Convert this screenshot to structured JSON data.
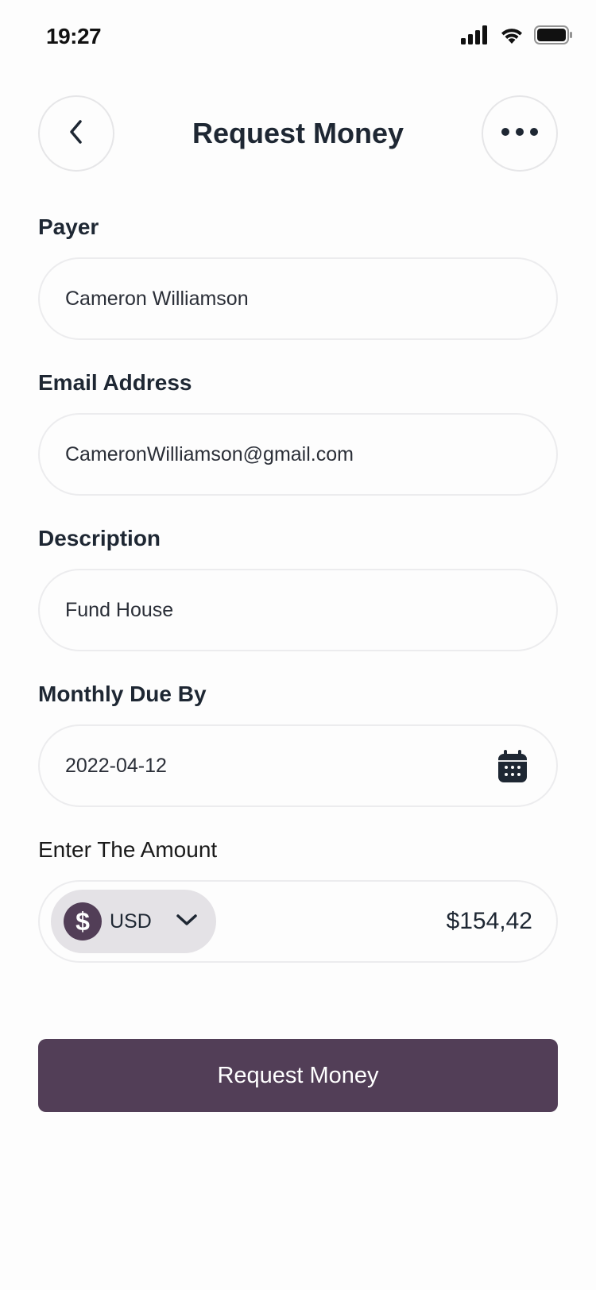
{
  "status_bar": {
    "time": "19:27"
  },
  "header": {
    "title": "Request Money",
    "back_icon": "chevron-left-icon",
    "more_icon": "more-horizontal-icon"
  },
  "form": {
    "payer": {
      "label": "Payer",
      "value": "Cameron Williamson"
    },
    "email": {
      "label": "Email Address",
      "value": "CameronWilliamson@gmail.com"
    },
    "description": {
      "label": "Description",
      "value": "Fund House"
    },
    "due_date": {
      "label": "Monthly Due By",
      "value": "2022-04-12",
      "icon": "calendar-icon"
    },
    "amount": {
      "label": "Enter The Amount",
      "currency_symbol": "$",
      "currency_code": "USD",
      "value": "$154,42"
    }
  },
  "submit": {
    "label": "Request Money"
  },
  "colors": {
    "primary": "#523e57",
    "pill": "#e4e2e6",
    "text": "#1e2733",
    "border": "#ececee",
    "background": "#fdfdfd"
  }
}
